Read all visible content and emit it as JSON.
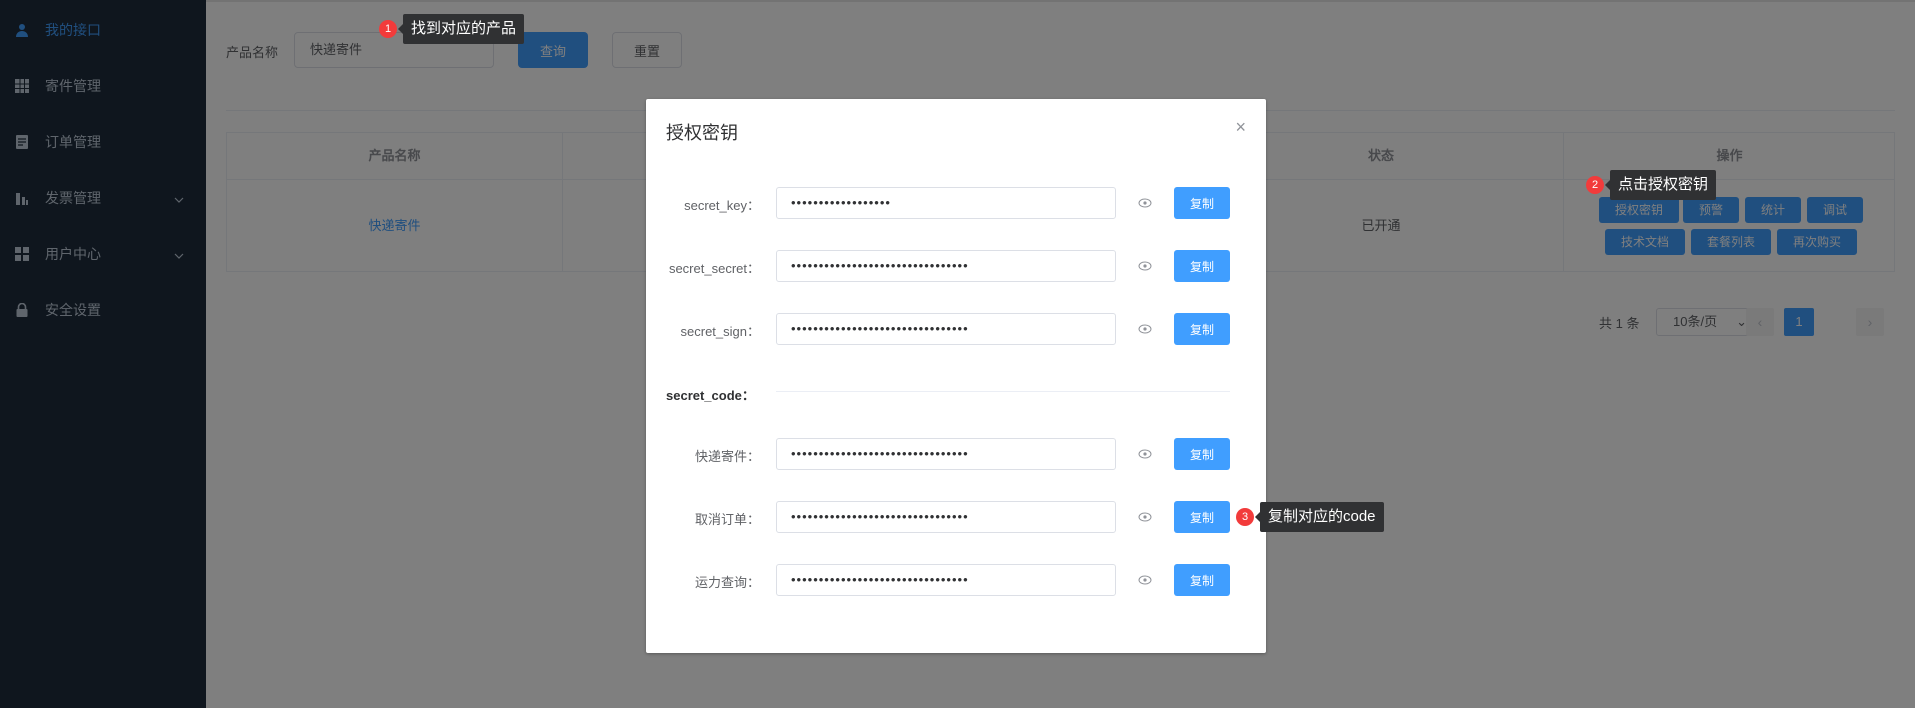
{
  "sidebar": {
    "items": [
      {
        "label": "我的接口",
        "icon": "user-icon",
        "active": true
      },
      {
        "label": "寄件管理",
        "icon": "grid-icon"
      },
      {
        "label": "订单管理",
        "icon": "document-icon"
      },
      {
        "label": "发票管理",
        "icon": "bar-chart-icon",
        "expandable": true
      },
      {
        "label": "用户中心",
        "icon": "apps-icon",
        "expandable": true
      },
      {
        "label": "安全设置",
        "icon": "lock-icon"
      }
    ]
  },
  "filter": {
    "label": "产品名称",
    "value": "快递寄件",
    "search_label": "查询",
    "reset_label": "重置"
  },
  "table": {
    "columns": [
      "产品名称",
      "状态",
      "操作"
    ],
    "rows": [
      {
        "product": "快递寄件",
        "status": "已开通"
      }
    ],
    "actions": [
      "授权密钥",
      "预警",
      "统计",
      "调试",
      "技术文档",
      "套餐列表",
      "再次购买"
    ]
  },
  "pagination": {
    "total": "共 1 条",
    "page_size": "10条/页",
    "current": "1"
  },
  "dialog": {
    "title": "授权密钥",
    "close": "×",
    "copy_label": "复制",
    "fields": [
      {
        "label": "secret_key：",
        "value": "••••••••••••••••••"
      },
      {
        "label": "secret_secret：",
        "value": "••••••••••••••••••••••••••••••••"
      },
      {
        "label": "secret_sign：",
        "value": "••••••••••••••••••••••••••••••••"
      }
    ],
    "code_section": "secret_code：",
    "codes": [
      {
        "label": "快递寄件：",
        "value": "••••••••••••••••••••••••••••••••"
      },
      {
        "label": "取消订单：",
        "value": "••••••••••••••••••••••••••••••••"
      },
      {
        "label": "运力查询：",
        "value": "••••••••••••••••••••••••••••••••"
      }
    ]
  },
  "steps": [
    {
      "num": "1",
      "text": "找到对应的产品"
    },
    {
      "num": "2",
      "text": "点击授权密钥"
    },
    {
      "num": "3",
      "text": "复制对应的code"
    }
  ],
  "colors": {
    "primary": "#409eff",
    "sidebar_bg": "#1f2d3d",
    "step_badge": "#f23b3b",
    "tooltip_bg": "#303133"
  }
}
